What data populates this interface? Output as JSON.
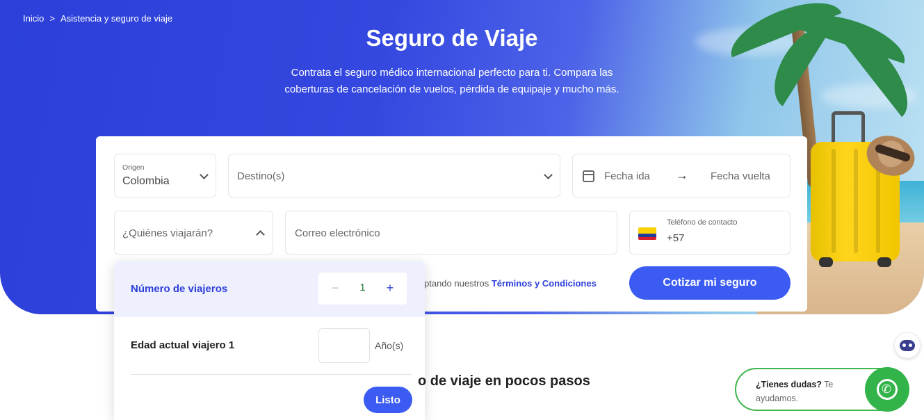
{
  "breadcrumb": {
    "home": "Inicio",
    "separator": ">",
    "current": "Asistencia y seguro de viaje"
  },
  "hero": {
    "title": "Seguro de Viaje",
    "subtitle": "Contrata el seguro médico internacional perfecto para ti. Compara las coberturas de cancelación de vuelos, pérdida de equipaje y mucho más."
  },
  "form": {
    "origin": {
      "label": "Origen",
      "value": "Colombia"
    },
    "destination": {
      "placeholder": "Destino(s)"
    },
    "dates": {
      "departure_placeholder": "Fecha ida",
      "return_placeholder": "Fecha vuelta"
    },
    "travelers": {
      "placeholder": "¿Quiénes viajarán?"
    },
    "email": {
      "placeholder": "Correo electrónico"
    },
    "phone": {
      "label": "Teléfono de contacto",
      "prefix": "+57"
    },
    "terms_prefix": "ptando nuestros ",
    "terms_link": "Términos y Condiciones",
    "submit_label": "Cotizar mi seguro"
  },
  "travelers_dropdown": {
    "count_label": "Número de viajeros",
    "count_value": "1",
    "minus": "−",
    "plus": "+",
    "age_label": "Edad actual viajero 1",
    "age_unit": "Año(s)",
    "done_label": "Listo"
  },
  "section": {
    "title_fragment": "o de viaje en pocos pasos"
  },
  "help": {
    "bold": "¿Tienes dudas?",
    "rest": " Te ayudamos."
  },
  "colors": {
    "brand_blue": "#2c3fd9",
    "button_blue": "#3b5bf2",
    "whatsapp_green": "#32b44a"
  }
}
